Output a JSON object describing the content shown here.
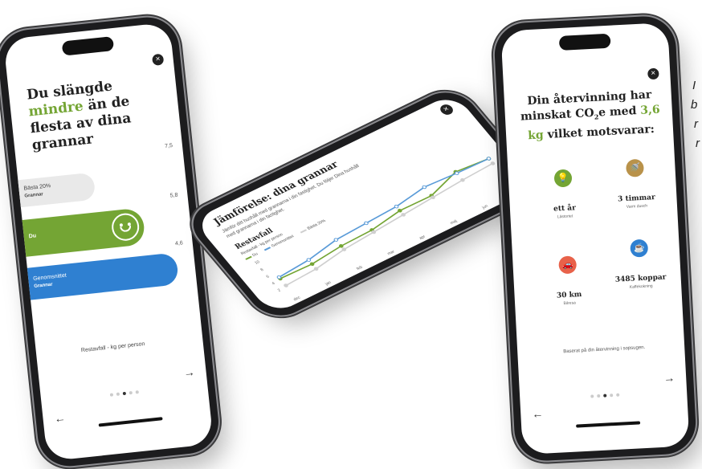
{
  "phone_left": {
    "headline_before": "Du slängde ",
    "headline_highlight": "mindre",
    "headline_after": " än de flesta av dina grannar",
    "axis_ticks": [
      "7,5",
      "5,8",
      "4,6"
    ],
    "bars": [
      {
        "title": "Bästa 20%",
        "sub": "Grannar",
        "color": "#e9e9e9"
      },
      {
        "title": "Du",
        "sub": "",
        "color": "#74a534"
      },
      {
        "title": "Genomsnittet",
        "sub": "Grannar",
        "color": "#2f80d1"
      }
    ],
    "caption": "Restavfall - kg per person",
    "next_arrow": "→",
    "back_arrow": "←"
  },
  "phone_middle": {
    "title": "Jämförelse: dina grannar",
    "intro": "Jämför ditt hushåll med grannarna i din fastighet. Du följer Dina hushåll med grannarna i din fastighet.",
    "section_title": "Restavfall",
    "section_sub": "Restavfall - kg per person",
    "legend": [
      "Du",
      "Genomsnittet",
      "Bästa 20%"
    ],
    "chart_data": {
      "type": "line",
      "categories": [
        "dec",
        "jan",
        "feb",
        "mar",
        "apr",
        "maj",
        "jun",
        "jul"
      ],
      "y_ticks": [
        "10",
        "8",
        "6",
        "4",
        "2"
      ],
      "series": [
        {
          "name": "Du",
          "color": "#74a534",
          "values": [
            4.2,
            4.0,
            4.8,
            5.0,
            6.2,
            6.1,
            8.6,
            8.0
          ]
        },
        {
          "name": "Genomsnittet",
          "color": "#5a9bd8",
          "values": [
            4.6,
            5.2,
            6.6,
            7.0,
            7.4,
            8.6,
            8.2,
            8.0
          ]
        },
        {
          "name": "Bästa 20%",
          "color": "#cfcfcf",
          "values": [
            2.2,
            2.6,
            3.8,
            4.4,
            5.0,
            5.6,
            6.2,
            6.6
          ]
        }
      ]
    }
  },
  "phone_right": {
    "headline_before": "Din återvinning har minskat CO",
    "headline_sub": "2",
    "headline_mid": "e med ",
    "headline_highlight": "3,6 kg",
    "headline_after": " vilket motsvarar:",
    "items": [
      {
        "value": "ett år",
        "label": "Lästortet",
        "icon": "lightbulb-icon",
        "color": "#74a534",
        "glyph": "💡"
      },
      {
        "value": "3 timmar",
        "label": "Varm dusch",
        "icon": "shower-icon",
        "color": "#b9924a",
        "glyph": "🚿"
      },
      {
        "value": "30 km",
        "label": "Bilresa",
        "icon": "car-icon",
        "color": "#e8624a",
        "glyph": "🚗"
      },
      {
        "value": "3485 koppar",
        "label": "Kaffekokning",
        "icon": "coffee-icon",
        "color": "#2f80d1",
        "glyph": "☕"
      }
    ],
    "footer": "Baserat på din återvinning i sopsugen.",
    "next_arrow": "→",
    "back_arrow": "←"
  },
  "fragment_text": [
    "I",
    "b",
    "r",
    "r"
  ],
  "close_symbol": "×"
}
